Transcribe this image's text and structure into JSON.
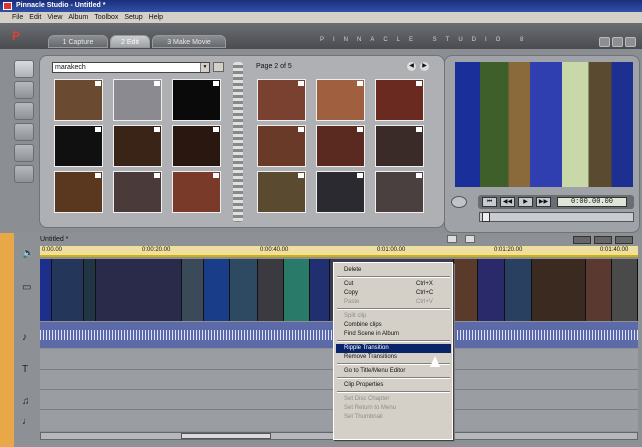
{
  "window": {
    "title": "Pinnacle Studio - Untitled *"
  },
  "menubar": [
    "File",
    "Edit",
    "View",
    "Album",
    "Toolbox",
    "Setup",
    "Help"
  ],
  "tabs": [
    {
      "label": "1 Capture",
      "active": false
    },
    {
      "label": "2 Edit",
      "active": true
    },
    {
      "label": "3 Make Movie",
      "active": false
    }
  ],
  "brand": "PINNACLE STUDIO 8",
  "album": {
    "dropdown_value": "marakech",
    "page_label": "Page 2 of 5"
  },
  "thumb_colors": [
    "#6a4a30",
    "#8a8a90",
    "#0a0a0a",
    "#101010",
    "#3a2418",
    "#2a1810",
    "#5a3820",
    "#4a3a3a",
    "#7a3a2a",
    "#7a4030",
    "#a06040",
    "#6a2a20",
    "#6a3a28",
    "#5a2a20",
    "#3a2a28",
    "#5a4a30",
    "#2a2a30",
    "#4a4040"
  ],
  "preview": {
    "timecode": "0:00.00.00"
  },
  "timeline": {
    "title": "Untitled *",
    "ticks": [
      "0:00.00",
      "0:00:20.00",
      "0:00:40.00",
      "0:01:00.00",
      "0:01:20.00",
      "0:01:40.00"
    ]
  },
  "clip_colors": [
    "#1d2f8a",
    "#24365a",
    "#223544",
    "#2a2a4a",
    "#3a4a58",
    "#1a3d8a",
    "#2d4a62",
    "#3a3a40",
    "#2a7a6a",
    "#1f2f70",
    "#3a3a50",
    "#5a3a2a",
    "#2a2a6a",
    "#2a4060",
    "#3a2a20",
    "#5a3a30",
    "#4a4a4a"
  ],
  "context_menu": {
    "items": [
      {
        "label": "Delete",
        "shortcut": "",
        "disabled": false,
        "highlighted": false
      },
      {
        "sep": true
      },
      {
        "label": "Cut",
        "shortcut": "Ctrl+X",
        "disabled": false,
        "highlighted": false
      },
      {
        "label": "Copy",
        "shortcut": "Ctrl+C",
        "disabled": false,
        "highlighted": false
      },
      {
        "label": "Paste",
        "shortcut": "Ctrl+V",
        "disabled": true,
        "highlighted": false
      },
      {
        "sep": true
      },
      {
        "label": "Split clip",
        "shortcut": "",
        "disabled": true,
        "highlighted": false
      },
      {
        "label": "Combine clips",
        "shortcut": "",
        "disabled": false,
        "highlighted": false
      },
      {
        "label": "Find Scene in Album",
        "shortcut": "",
        "disabled": false,
        "highlighted": false
      },
      {
        "sep": true
      },
      {
        "label": "Ripple Transition",
        "shortcut": "",
        "disabled": false,
        "highlighted": true
      },
      {
        "label": "Remove Transitions",
        "shortcut": "",
        "disabled": false,
        "highlighted": false
      },
      {
        "sep": true
      },
      {
        "label": "Go to Title/Menu Editor",
        "shortcut": "",
        "disabled": false,
        "highlighted": false
      },
      {
        "sep": true
      },
      {
        "label": "Clip Properties",
        "shortcut": "",
        "disabled": false,
        "highlighted": false
      },
      {
        "sep": true
      },
      {
        "label": "Set Disc Chapter",
        "shortcut": "",
        "disabled": true,
        "highlighted": false
      },
      {
        "label": "Set Return to Menu",
        "shortcut": "",
        "disabled": true,
        "highlighted": false
      },
      {
        "label": "Set Thumbnail",
        "shortcut": "",
        "disabled": true,
        "highlighted": false
      }
    ]
  }
}
